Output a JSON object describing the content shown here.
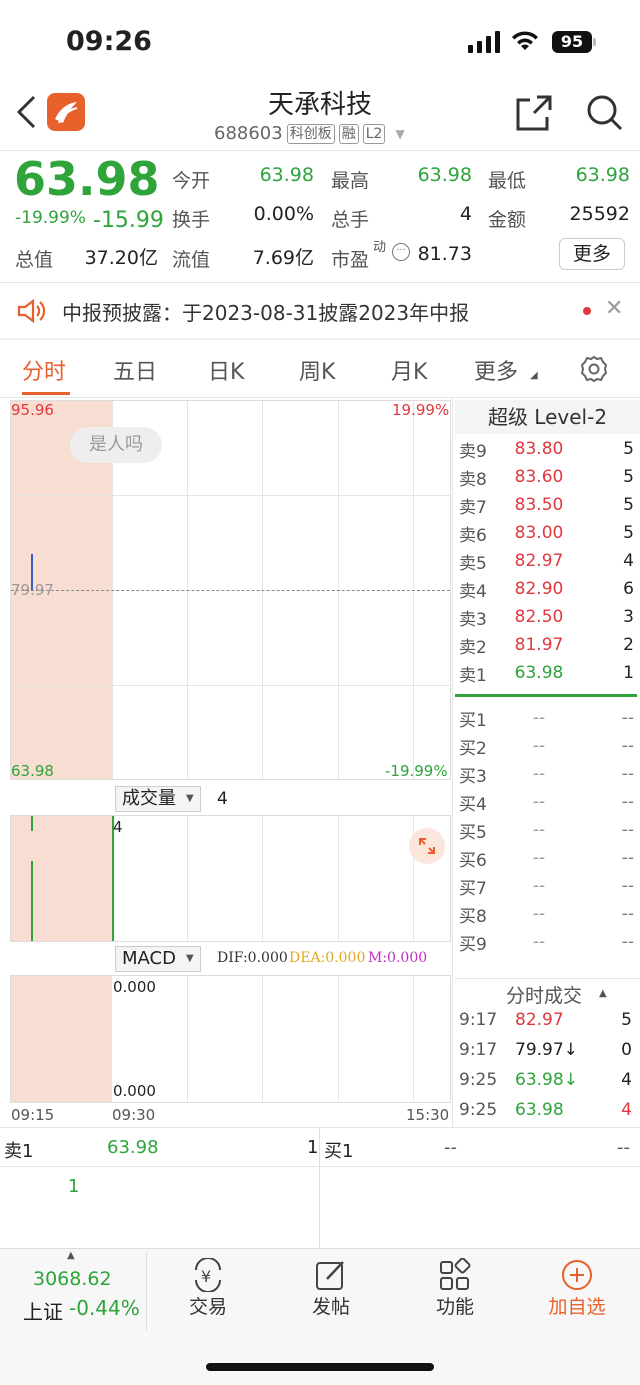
{
  "status": {
    "time": "09:26",
    "battery": "95"
  },
  "header": {
    "title": "天承科技",
    "code": "688603",
    "tags": [
      "科创板",
      "融",
      "L2"
    ]
  },
  "quote": {
    "price": "63.98",
    "change_pct": "-19.99%",
    "change": "-15.99",
    "open_label": "今开",
    "open": "63.98",
    "high_label": "最高",
    "high": "63.98",
    "low_label": "最低",
    "low": "63.98",
    "turnover_label": "换手",
    "turnover": "0.00%",
    "volume_label": "总手",
    "volume": "4",
    "amount_label": "金额",
    "amount": "25592",
    "mktcap_label": "总值",
    "mktcap": "37.20亿",
    "float_label": "流值",
    "float": "7.69亿",
    "pe_label": "市盈",
    "pe_sup": "动",
    "pe": "81.73",
    "more": "更多"
  },
  "notice": {
    "text": "中报预披露：于2023-08-31披露2023年中报"
  },
  "tabs": [
    "分时",
    "五日",
    "日K",
    "周K",
    "月K",
    "更多"
  ],
  "chart": {
    "top_left": "95.96",
    "top_right": "19.99%",
    "mid_left": "79.97",
    "bottom_left": "63.98",
    "bottom_right": "-19.99%",
    "overlay": "是人吗",
    "volume_select": "成交量",
    "volume_value": "4",
    "volume_bar_label": "4",
    "macd_select": "MACD",
    "dif": "DIF:0.000",
    "dea": "DEA:0.000",
    "m": "M:0.000",
    "macd_top": "0.000",
    "macd_bottom": "0.000",
    "time_start": "09:15",
    "time_mid": "09:30",
    "time_end": "15:30"
  },
  "orderbook": {
    "title": "超级 Level-2",
    "asks": [
      {
        "label": "卖9",
        "price": "83.80",
        "vol": "5"
      },
      {
        "label": "卖8",
        "price": "83.60",
        "vol": "5"
      },
      {
        "label": "卖7",
        "price": "83.50",
        "vol": "5"
      },
      {
        "label": "卖6",
        "price": "83.00",
        "vol": "5"
      },
      {
        "label": "卖5",
        "price": "82.97",
        "vol": "4"
      },
      {
        "label": "卖4",
        "price": "82.90",
        "vol": "6"
      },
      {
        "label": "卖3",
        "price": "82.50",
        "vol": "3"
      },
      {
        "label": "卖2",
        "price": "81.97",
        "vol": "2"
      },
      {
        "label": "卖1",
        "price": "63.98",
        "vol": "1"
      }
    ],
    "bids": [
      {
        "label": "买1",
        "price": "--",
        "vol": "--"
      },
      {
        "label": "买2",
        "price": "--",
        "vol": "--"
      },
      {
        "label": "买3",
        "price": "--",
        "vol": "--"
      },
      {
        "label": "买4",
        "price": "--",
        "vol": "--"
      },
      {
        "label": "买5",
        "price": "--",
        "vol": "--"
      },
      {
        "label": "买6",
        "price": "--",
        "vol": "--"
      },
      {
        "label": "买7",
        "price": "--",
        "vol": "--"
      },
      {
        "label": "买8",
        "price": "--",
        "vol": "--"
      },
      {
        "label": "买9",
        "price": "--",
        "vol": "--"
      }
    ],
    "trades_title": "分时成交",
    "trades": [
      {
        "time": "9:17",
        "price": "82.97",
        "vol": "5"
      },
      {
        "time": "9:17",
        "price": "79.97↓",
        "vol": "0"
      },
      {
        "time": "9:25",
        "price": "63.98↓",
        "vol": "4"
      },
      {
        "time": "9:25",
        "price": "63.98",
        "vol": "4"
      }
    ]
  },
  "bottom_quote": {
    "ask_label": "卖1",
    "ask_price": "63.98",
    "ask_vol": "1",
    "bid_label": "买1",
    "bid_price": "--",
    "bid_vol": "--",
    "detail": "1"
  },
  "nav": {
    "index_value": "3068.62",
    "index_name": "上证",
    "index_change": "-0.44%",
    "items": [
      "交易",
      "发帖",
      "功能",
      "加自选"
    ]
  }
}
